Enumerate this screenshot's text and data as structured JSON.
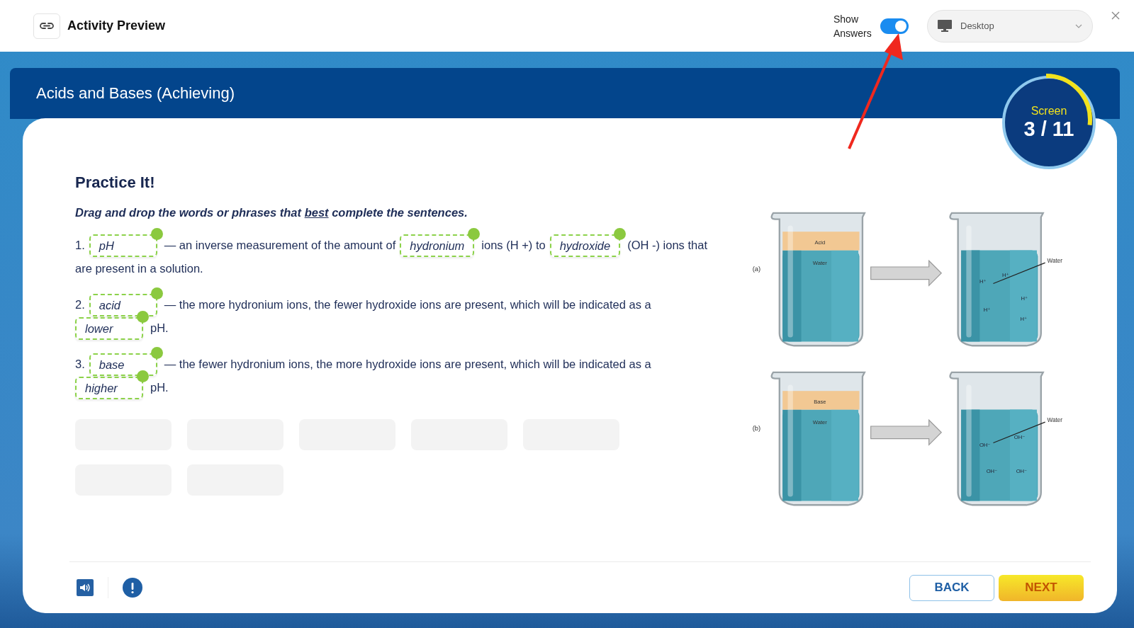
{
  "topbar": {
    "title": "Activity Preview",
    "show_answers": {
      "label": "Show Answers",
      "on": true
    },
    "device": {
      "value": "Desktop"
    }
  },
  "activity": {
    "title": "Acids and Bases (Achieving)",
    "screen": {
      "label": "Screen",
      "count": "3 / 11",
      "level": 0.27
    }
  },
  "heading": "Practice It!",
  "instruction": {
    "before": "Drag and drop the words or phrases that ",
    "underlined": "best",
    "after": " complete the sentences."
  },
  "sentences": [
    {
      "number": "1.",
      "lines": [
        [
          {
            "kind": "blank",
            "answer": "pH",
            "correct": true
          },
          {
            "kind": "text",
            "text": "— an inverse measurement of the amount of"
          },
          {
            "kind": "blank",
            "answer": "hydronium",
            "correct": true
          },
          {
            "kind": "text",
            "text": "ions (H +) to"
          },
          {
            "kind": "blank",
            "answer": "hydroxide",
            "correct": true
          },
          {
            "kind": "text",
            "text": "(OH -) ions that"
          }
        ],
        [
          {
            "kind": "text",
            "text": "are present in a solution."
          }
        ]
      ]
    },
    {
      "number": "2.",
      "lines": [
        [
          {
            "kind": "blank",
            "answer": "acid",
            "correct": true
          },
          {
            "kind": "text",
            "text": "— the more hydronium ions, the fewer hydroxide ions are present, which will be indicated as a"
          }
        ],
        [
          {
            "kind": "blank",
            "answer": "lower",
            "correct": true
          },
          {
            "kind": "text",
            "text": "pH."
          }
        ]
      ]
    },
    {
      "number": "3.",
      "lines": [
        [
          {
            "kind": "blank",
            "answer": "base",
            "correct": true
          },
          {
            "kind": "text",
            "text": "— the fewer hydronium ions, the more hydroxide ions are present, which will be indicated as a"
          }
        ],
        [
          {
            "kind": "blank",
            "answer": "higher",
            "correct": true
          },
          {
            "kind": "text",
            "text": "pH."
          }
        ]
      ]
    }
  ],
  "word_bank": [
    {
      "filled": false
    },
    {
      "filled": false
    },
    {
      "filled": false
    },
    {
      "filled": false
    },
    {
      "filled": false
    },
    {
      "filled": false
    },
    {
      "filled": false
    }
  ],
  "figure": {
    "panels": [
      {
        "label": "(a)",
        "layer": "Acid",
        "water": "Water",
        "ions": [
          "H⁺",
          "H⁺",
          "H⁺",
          "H⁺",
          "H⁺"
        ],
        "callout": "Water"
      },
      {
        "label": "(b)",
        "layer": "Base",
        "water": "Water",
        "ions": [
          "OH⁻",
          "OH⁻",
          "OH⁻",
          "OH⁻"
        ],
        "callout": "Water"
      }
    ]
  },
  "footer": {
    "back": "BACK",
    "next": "NEXT"
  }
}
